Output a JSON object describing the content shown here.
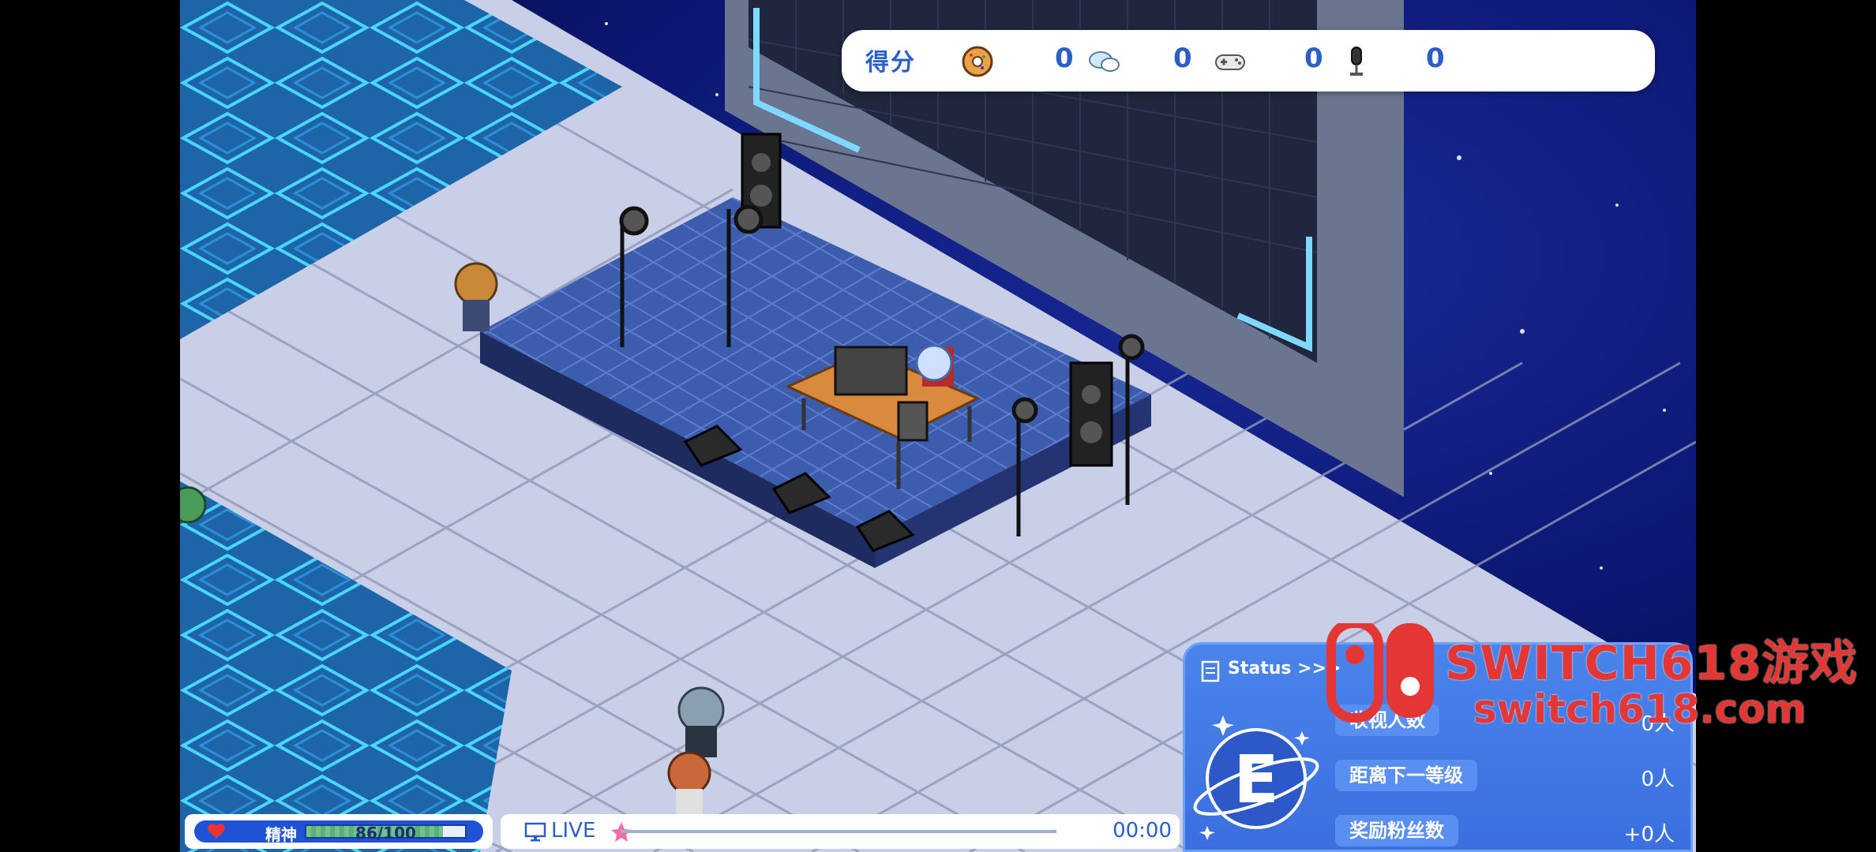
{
  "score": {
    "label": "得分",
    "items": [
      {
        "icon": "donut-icon",
        "value": "0"
      },
      {
        "icon": "chat-bubbles-icon",
        "value": "0"
      },
      {
        "icon": "gamepad-icon",
        "value": "0"
      },
      {
        "icon": "microphone-icon",
        "value": "0"
      }
    ]
  },
  "spirit": {
    "label": "精神",
    "value_text": "86/100",
    "fraction": 0.86,
    "icon": "heart-icon"
  },
  "live": {
    "label": "LIVE",
    "time": "00:00",
    "progress": 0,
    "icon": "monitor-icon",
    "marker_icon": "star-icon"
  },
  "status": {
    "title": "Status >>>",
    "emblem_letter": "E",
    "rows": [
      {
        "label": "收视人数",
        "value": "0人",
        "icon": "people-icon"
      },
      {
        "label": "距离下一等级",
        "value": "0人"
      },
      {
        "label": "奖励粉丝数",
        "value": "+0人"
      }
    ]
  },
  "watermark": {
    "line1": "SWITCH618游戏",
    "line2": "switch618.com"
  },
  "colors": {
    "accent": "#2a5fc9",
    "panel": "#3b6fe0",
    "watermark": "#e53636"
  }
}
